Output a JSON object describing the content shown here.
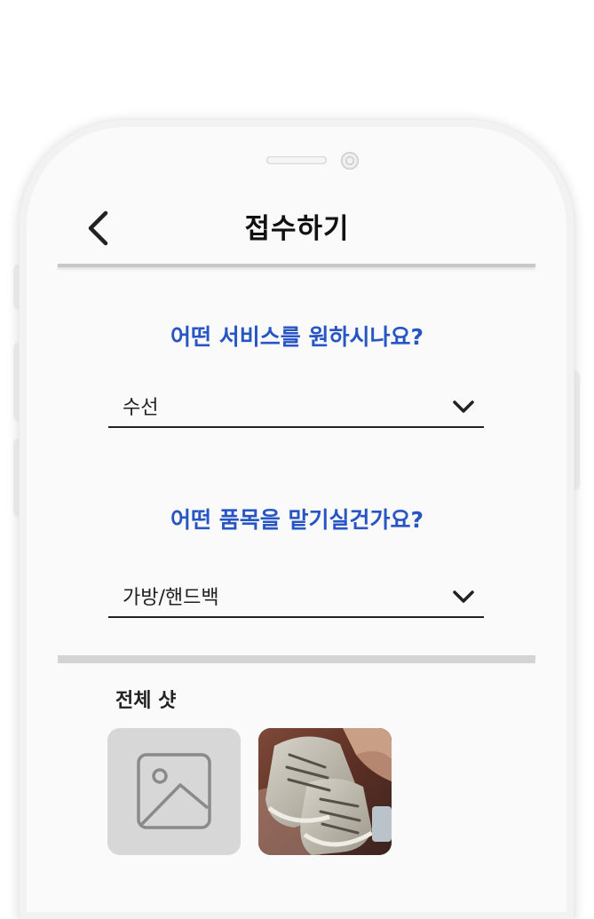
{
  "header": {
    "title": "접수하기"
  },
  "service": {
    "question": "어떤 서비스를 원하시나요?",
    "selected": "수선"
  },
  "item": {
    "question": "어떤 품목을 맡기실건가요?",
    "selected": "가방/핸드백"
  },
  "photos": {
    "section_title": "전체 샷"
  },
  "icons": {
    "back": "chevron-left-icon",
    "dropdown": "chevron-down-icon",
    "image_placeholder": "image-icon"
  },
  "colors": {
    "accent": "#2756c4",
    "text": "#222222",
    "divider": "#d4d4d4",
    "placeholder_bg": "#d7d7d7"
  }
}
